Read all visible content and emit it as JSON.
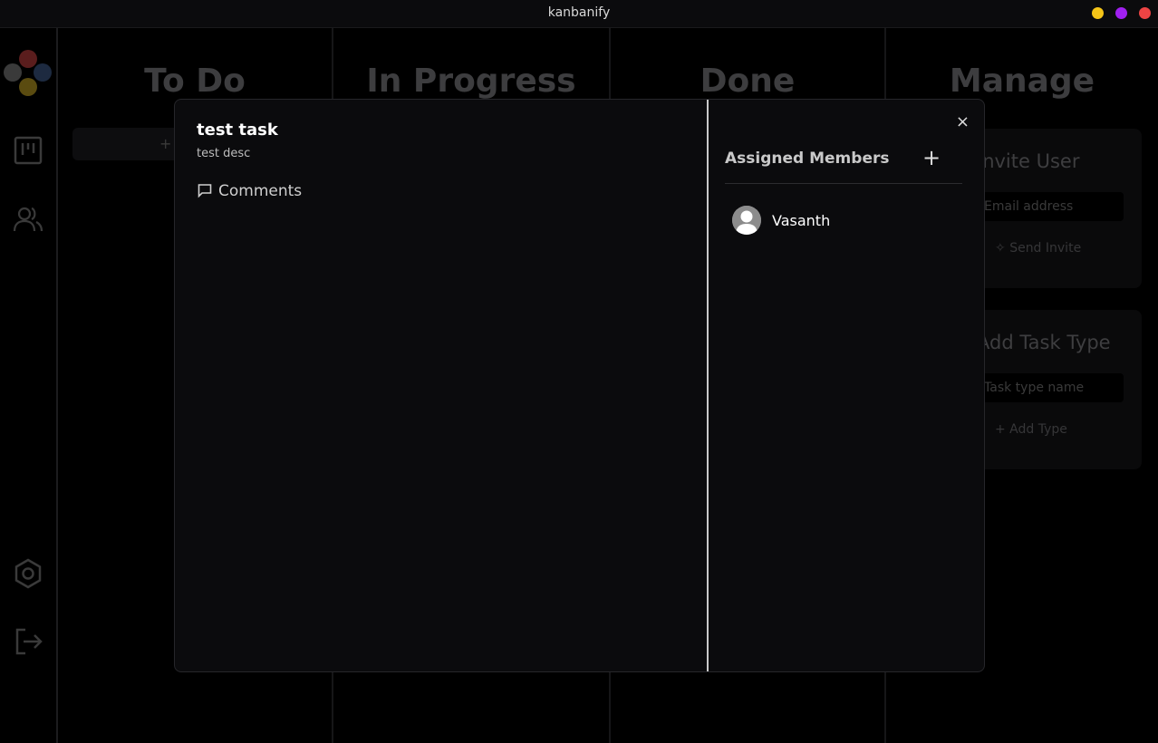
{
  "window": {
    "title": "kanbanify",
    "controls": {
      "minimize_color": "#f5c518",
      "maximize_color": "#a020f0",
      "close_color": "#ee4444"
    }
  },
  "sidebar": {
    "items": [
      {
        "icon": "logo-icon"
      },
      {
        "icon": "kanban-board-icon"
      },
      {
        "icon": "users-icon"
      },
      {
        "icon": "settings-icon"
      },
      {
        "icon": "logout-icon"
      }
    ]
  },
  "board": {
    "columns": [
      {
        "title": "To Do",
        "add_label": "+"
      },
      {
        "title": "In Progress"
      },
      {
        "title": "Done"
      },
      {
        "title": "Manage"
      }
    ]
  },
  "manage": {
    "invite": {
      "title": "Invite User",
      "placeholder": "Email address",
      "button_label": "Send Invite",
      "button_icon": "sparkle-icon"
    },
    "task_type": {
      "title": "Add Task Type",
      "placeholder": "Task type name",
      "button_label": "+  Add Type"
    }
  },
  "modal": {
    "task_title": "test task",
    "task_desc": "test desc",
    "comments_label": "Comments",
    "close_label": "×",
    "assigned_title": "Assigned Members",
    "add_member_label": "+",
    "members": [
      {
        "name": "Vasanth"
      }
    ]
  }
}
